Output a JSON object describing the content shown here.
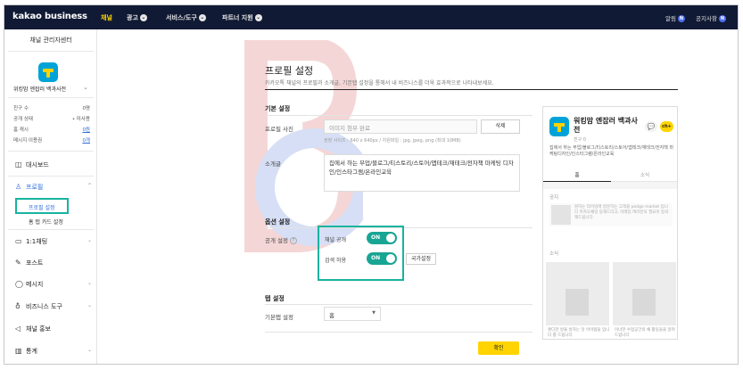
{
  "nav": {
    "logo": "kakao business",
    "items": [
      {
        "label": "채널",
        "active": true
      },
      {
        "label": "광고",
        "active": false,
        "has_chevron": true
      },
      {
        "label": "서비스/도구",
        "active": false,
        "has_chevron": true
      },
      {
        "label": "파트너 지원",
        "active": false,
        "has_chevron": true
      }
    ],
    "alerts_label": "알림",
    "alerts_badge": "N",
    "notices_label": "공지사항",
    "notices_badge": "N"
  },
  "sidebar": {
    "title": "채널 관리자센터",
    "channel_name": "위킹맘 엔잡러 백과사전",
    "stats": [
      {
        "label": "친구 수",
        "value": "0명",
        "link": false
      },
      {
        "label": "공개 상태",
        "value": "• 미사용",
        "link": false
      },
      {
        "label": "홈 캐시",
        "value": "0원",
        "link": true
      },
      {
        "label": "메시지 이용권",
        "value": "0개",
        "link": true
      }
    ],
    "menu": [
      {
        "label": "대시보드",
        "icon": "dashboard-icon",
        "glyph": "◫",
        "chevron": false
      },
      {
        "label": "프로필",
        "icon": "profile-icon",
        "glyph": "♙",
        "chevron": true,
        "active": true
      },
      {
        "label": "1:1채팅",
        "icon": "chat-icon",
        "glyph": "▭",
        "chevron": true
      },
      {
        "label": "포스트",
        "icon": "post-icon",
        "glyph": "✎",
        "chevron": false
      },
      {
        "label": "메시지",
        "icon": "message-icon",
        "glyph": "◯",
        "chevron": true
      },
      {
        "label": "비즈니스 도구",
        "icon": "business-tool-icon",
        "glyph": "♁",
        "chevron": true
      },
      {
        "label": "채널 홍보",
        "icon": "promotion-icon",
        "glyph": "◁",
        "chevron": false
      },
      {
        "label": "통계",
        "icon": "stats-icon",
        "glyph": "▥",
        "chevron": true
      }
    ],
    "submenu": [
      {
        "label": "프로필 설정",
        "active": true
      },
      {
        "label": "홈 탭 카드 설정",
        "active": false
      }
    ]
  },
  "page": {
    "title": "프로필 설정",
    "description": "카카오톡 채널의 프로필과 소개글, 기본탭 설정을 통해서 내 비즈니스를 더욱 효과적으로 나타내보세요.",
    "basic": {
      "section_title": "기본 설정",
      "photo_label": "프로필 사진",
      "photo_placeholder": "이미지 첨부 완료",
      "delete_button": "삭제",
      "photo_hint": "권장 사이즈 : 640 x 640px / 지원파일 : jpg, jpeg, png (최대 10MB)",
      "intro_label": "소개글",
      "intro_value": "집에서 하는 부업/블로그/티스토리/스토어/앱테크/재테크/전자책 마케팅 디자인/인스타그램/온라인교육"
    },
    "options": {
      "section_title": "옵션 설정",
      "public_label": "공개 설정",
      "help": "?",
      "channel_public_label": "채널 공개",
      "channel_public_state": "ON",
      "search_allow_label": "검색 허용",
      "search_allow_state": "ON",
      "country_button": "국가설정"
    },
    "tab": {
      "section_title": "탭 설정",
      "default_tab_label": "기본탭 설정",
      "default_tab_value": "홈"
    },
    "confirm_button": "확인"
  },
  "preview": {
    "name": "워킹맘 엔잡러 백과사전",
    "friends": "친구 0",
    "chat_glyph": "💬",
    "channel_badge": "ch+",
    "description": "집에서 하는 부업/블로그/티스토리/스토어/앱테크/재테크/전자책 마케팅디자인/인스타그램/온라인교육",
    "tabs": [
      {
        "label": "홈",
        "active": true
      },
      {
        "label": "소식",
        "active": false
      }
    ],
    "notice_title": "공지",
    "notice_text": "원하는 타이밍에 방문하는 고객을 pedge market 입니다 카카오채널 동해드리고, 아래있 여러분의 필요이 등락해드립니다.",
    "news_title": "소식",
    "cards": [
      {
        "caption": "랜디한 방울 살자는 맛 아이템들 입니다 를 드립니다"
      },
      {
        "caption": "이너한 수업공간의 채 활동들을 알려드립니다"
      }
    ]
  },
  "colors": {
    "nav_bg": "#111a34",
    "nav_active": "#ffd400",
    "accent_teal": "#18b3a0",
    "toggle_on": "#18a594",
    "link_blue": "#2d6cdf",
    "yellow": "#ffd400"
  }
}
